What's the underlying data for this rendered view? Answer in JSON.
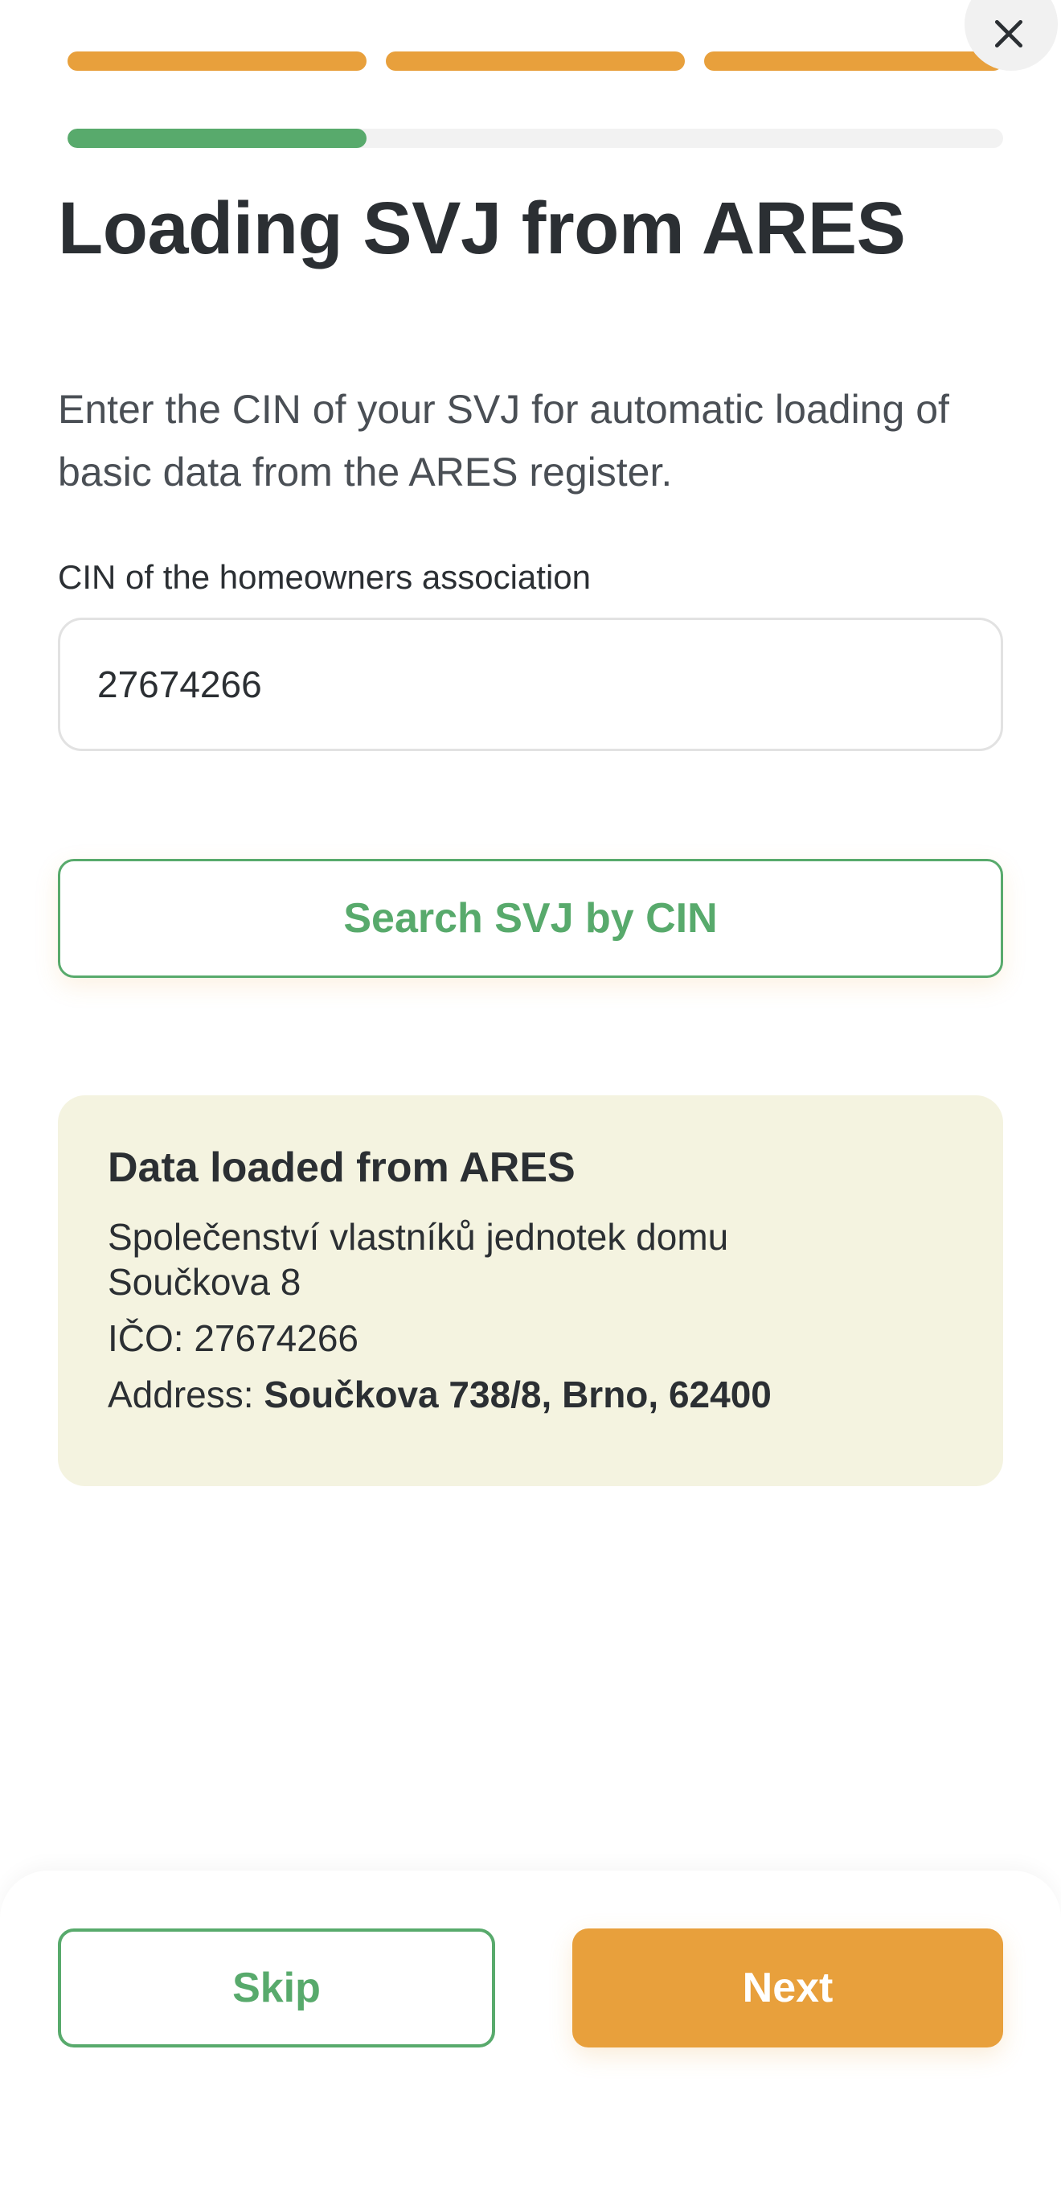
{
  "colors": {
    "accent_orange": "#e8a03c",
    "accent_green": "#58aa6c",
    "card_bg": "#f4f3e0",
    "track_gray": "#f2f2f2"
  },
  "header": {
    "steps_total": 3,
    "steps_completed": 3,
    "close_icon": "close-icon",
    "substep_progress": 0.32
  },
  "main": {
    "title": "Loading SVJ from ARES",
    "intro": "Enter the CIN of your SVJ for automatic loading of basic data from the ARES register.",
    "cin_label": "CIN of the homeowners association",
    "cin_value": "27674266",
    "search_button": "Search SVJ by CIN"
  },
  "ares_card": {
    "heading": "Data loaded from ARES",
    "name": "Společenství vlastníků jednotek domu Součkova 8",
    "ico_label": "IČO:",
    "ico_value": "27674266",
    "address_label": "Address:",
    "address_value": "Součkova 738/8, Brno, 62400"
  },
  "footer": {
    "skip_label": "Skip",
    "next_label": "Next"
  }
}
